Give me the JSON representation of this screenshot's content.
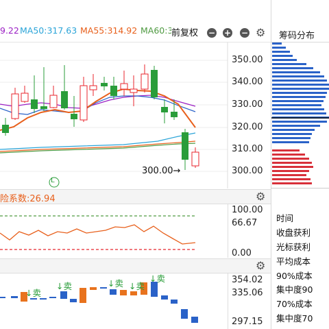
{
  "header": {
    "ma_labels": [
      {
        "text": "9.22",
        "color": "#9b1fc4"
      },
      {
        "text": "MA50:317.63",
        "color": "#2aa4d8"
      },
      {
        "text": "MA55:314.92",
        "color": "#e8601c"
      },
      {
        "text": "MA60:3",
        "color": "#4f9a42"
      }
    ],
    "adjust_label": "前复权",
    "right_title": "筹码分布",
    "controls": {
      "zoom_out": "minus-circle",
      "zoom_in": "plus-circle",
      "collapse": "minus-circle",
      "settings": "gear"
    }
  },
  "main_chart": {
    "y_ticks": [
      "350.00",
      "340.00",
      "330.00",
      "320.00",
      "310.00",
      "300.00"
    ],
    "price_annotation": "300.00→",
    "marker_label": "L",
    "colors": {
      "up": "#e8262e",
      "down": "#2a9d3a",
      "ma_purple": "#9b1fc4",
      "ma_blue": "#2aa4d8",
      "ma_orange": "#e8601c",
      "ma_green": "#4f9a42"
    }
  },
  "risk_panel": {
    "label": "险系数:26.94",
    "label_color": "#e8601c",
    "y_ticks": [
      "100.00",
      "66.67",
      "0.00"
    ]
  },
  "signal_panel": {
    "y_ticks": [
      "354.02",
      "335.06",
      "297.15"
    ],
    "sell_labels": [
      "↓卖",
      "↓卖",
      "↓卖",
      "↓卖",
      "↓卖"
    ]
  },
  "chip_stats": {
    "items": [
      "时间",
      "收盘获利",
      "光标获利",
      "平均成本",
      "90%成本",
      "集中度90",
      "70%成本",
      "集中度70"
    ]
  }
}
